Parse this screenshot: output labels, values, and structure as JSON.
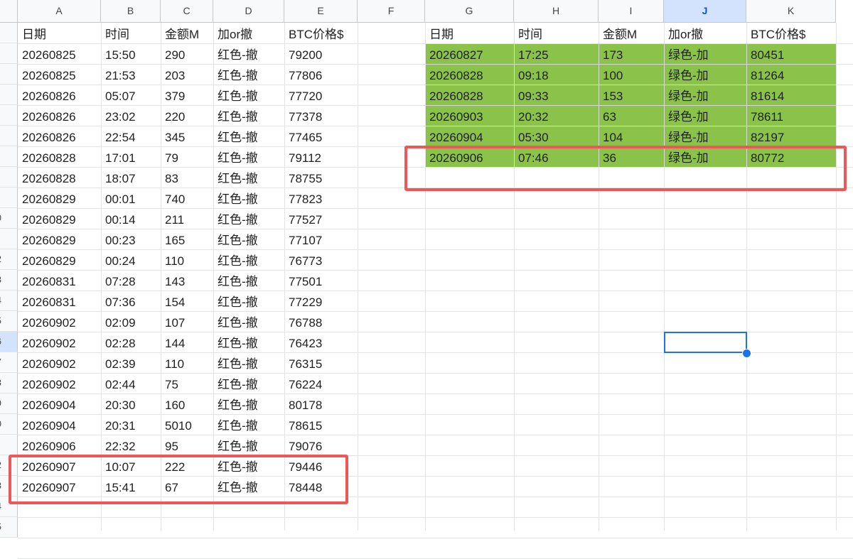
{
  "columns": [
    "A",
    "B",
    "C",
    "D",
    "E",
    "F",
    "G",
    "H",
    "I",
    "J",
    "K"
  ],
  "selected_column": "J",
  "row_header_fragments": [
    "",
    "",
    "",
    "",
    "",
    "",
    "",
    "",
    "",
    "0",
    "",
    "2",
    "3",
    "4",
    "5",
    "6",
    "7",
    "3",
    "9",
    "0",
    "",
    "2",
    "3",
    "4",
    "5"
  ],
  "left_table": {
    "headers": [
      "日期",
      "时间",
      "金额M",
      "加or撤",
      "BTC价格$"
    ],
    "rows": [
      [
        "20260825",
        "15:50",
        "290",
        "红色-撤",
        "79200"
      ],
      [
        "20260825",
        "21:53",
        "203",
        "红色-撤",
        "77806"
      ],
      [
        "20260826",
        "05:07",
        "379",
        "红色-撤",
        "77720"
      ],
      [
        "20260826",
        "23:02",
        "220",
        "红色-撤",
        "77378"
      ],
      [
        "20260826",
        "22:54",
        "345",
        "红色-撤",
        "77465"
      ],
      [
        "20260828",
        "17:01",
        "79",
        "红色-撤",
        "79112"
      ],
      [
        "20260828",
        "18:07",
        "83",
        "红色-撤",
        "78755"
      ],
      [
        "20260829",
        "00:01",
        "740",
        "红色-撤",
        "77823"
      ],
      [
        "20260829",
        "00:14",
        "211",
        "红色-撤",
        "77527"
      ],
      [
        "20260829",
        "00:23",
        "165",
        "红色-撤",
        "77107"
      ],
      [
        "20260829",
        "00:24",
        "110",
        "红色-撤",
        "76773"
      ],
      [
        "20260831",
        "07:28",
        "143",
        "红色-撤",
        "77501"
      ],
      [
        "20260831",
        "07:36",
        "154",
        "红色-撤",
        "77229"
      ],
      [
        "20260902",
        "02:09",
        "107",
        "红色-撤",
        "76788"
      ],
      [
        "20260902",
        "02:28",
        "144",
        "红色-撤",
        "76423"
      ],
      [
        "20260902",
        "02:39",
        "110",
        "红色-撤",
        "76315"
      ],
      [
        "20260902",
        "02:44",
        "75",
        "红色-撤",
        "76224"
      ],
      [
        "20260904",
        "20:30",
        "160",
        "红色-撤",
        "80178"
      ],
      [
        "20260904",
        "20:31",
        "5010",
        "红色-撤",
        "78615"
      ],
      [
        "20260906",
        "22:32",
        "95",
        "红色-撤",
        "79076"
      ],
      [
        "20260907",
        "10:07",
        "222",
        "红色-撤",
        "79446"
      ],
      [
        "20260907",
        "15:41",
        "67",
        "红色-撤",
        "78448"
      ]
    ]
  },
  "right_table": {
    "headers": [
      "日期",
      "时间",
      "金额M",
      "加or撤",
      "BTC价格$"
    ],
    "rows": [
      [
        "20260827",
        "17:25",
        "173",
        "绿色-加",
        "80451"
      ],
      [
        "20260828",
        "09:18",
        "100",
        "绿色-加",
        "81264"
      ],
      [
        "20260828",
        "09:33",
        "153",
        "绿色-加",
        "81614"
      ],
      [
        "20260903",
        "20:32",
        "63",
        "绿色-加",
        "78611"
      ],
      [
        "20260904",
        "05:30",
        "104",
        "绿色-加",
        "82197"
      ],
      [
        "20260906",
        "07:46",
        "36",
        "绿色-加",
        "80772"
      ]
    ]
  },
  "colors": {
    "green_fill": "#8bc34a",
    "highlight_border": "#ee5757",
    "selection_blue": "#1a73e8",
    "selected_header": "#d3e3fd"
  }
}
